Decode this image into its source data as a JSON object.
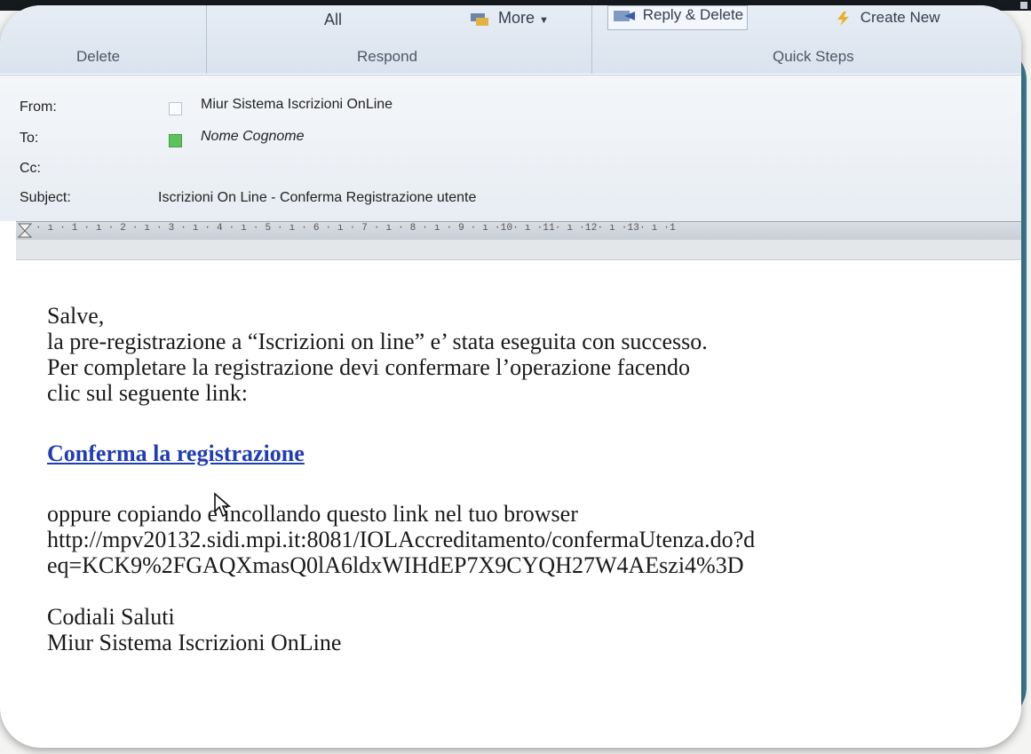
{
  "ribbon": {
    "all_label": "All",
    "more_label": "More",
    "reply_delete_label": "Reply & Delete",
    "create_new_label": "Create New",
    "groups": {
      "delete": "Delete",
      "respond": "Respond",
      "quick_steps": "Quick Steps"
    }
  },
  "header": {
    "from_label": "From:",
    "from_value": "Miur Sistema Iscrizioni OnLine",
    "to_label": "To:",
    "to_value": "Nome Cognome",
    "cc_label": "Cc:",
    "subject_label": "Subject:",
    "subject_value": "Iscrizioni On Line - Conferma Registrazione utente"
  },
  "ruler": {
    "ticks": "· ı · 1 · ı · 2 · ı · 3 · ı · 4 · ı · 5 · ı · 6 · ı · 7 · ı · 8 · ı · 9 · ı ·10· ı ·11· ı ·12· ı ·13· ı ·1"
  },
  "message": {
    "greeting": "Salve,",
    "line1": "la pre-registrazione a “Iscrizioni on line” e’ stata eseguita con successo.",
    "line2": "Per completare la registrazione devi confermare l’operazione facendo",
    "line3": "clic sul seguente link:",
    "confirm_link": "Conferma la registrazione",
    "line4": "oppure copiando e incollando questo link nel tuo browser",
    "url_line1": "http://mpv20132.sidi.mpi.it:8081/IOLAccreditamento/confermaUtenza.do?d",
    "url_line2": "eq=KCK9%2FGAQXmasQ0lA6ldxWIHdEP7X9CYQH27W4AEszi4%3D",
    "closing": "Codiali Saluti",
    "signature": "Miur Sistema Iscrizioni OnLine"
  },
  "colors": {
    "accent_panel": "#3f7c92",
    "link": "#1f3db4",
    "ribbon": "#dfe6f0"
  }
}
